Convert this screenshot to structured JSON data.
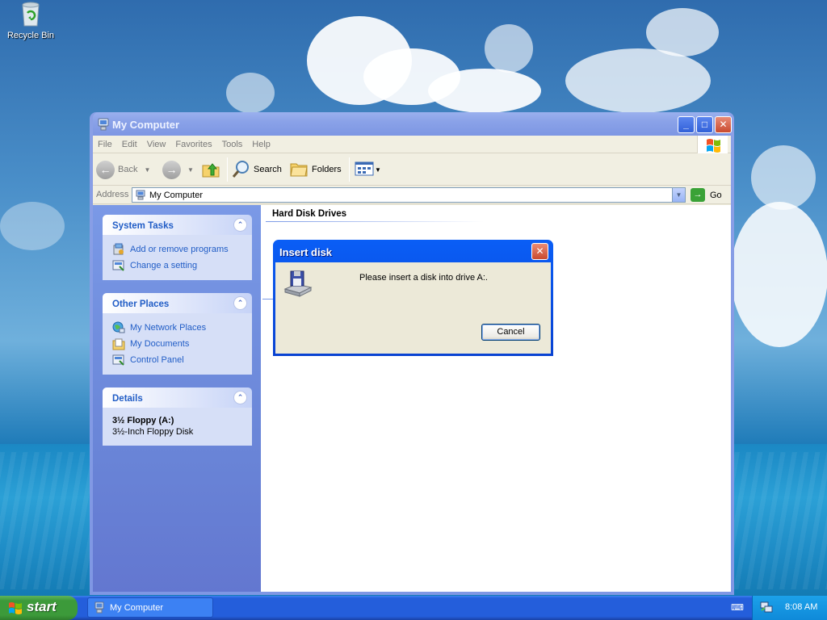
{
  "desktop": {
    "icons": [
      {
        "label": "Recycle Bin",
        "icon": "recycle-bin-icon"
      }
    ]
  },
  "window": {
    "title": "My Computer",
    "menu": [
      "File",
      "Edit",
      "View",
      "Favorites",
      "Tools",
      "Help"
    ],
    "toolbar": {
      "back": "Back",
      "search": "Search",
      "folders": "Folders"
    },
    "address": {
      "label": "Address",
      "value": "My Computer",
      "go": "Go"
    },
    "taskpane": {
      "system_tasks": {
        "title": "System Tasks",
        "items": [
          "Add or remove programs",
          "Change a setting"
        ]
      },
      "other_places": {
        "title": "Other Places",
        "items": [
          "My Network Places",
          "My Documents",
          "Control Panel"
        ]
      },
      "details": {
        "title": "Details",
        "name": "3½ Floppy (A:)",
        "type": "3½-Inch Floppy Disk"
      }
    },
    "main": {
      "section_title": "Hard Disk Drives"
    }
  },
  "dialog": {
    "title": "Insert disk",
    "message": "Please insert a disk into drive A:.",
    "cancel": "Cancel"
  },
  "taskbar": {
    "start": "start",
    "task": "My Computer",
    "clock": "8:08 AM"
  },
  "colors": {
    "xp_blue": "#0a5ef6",
    "taskpane_link": "#215dc6",
    "start_green": "#3c9a3a"
  }
}
